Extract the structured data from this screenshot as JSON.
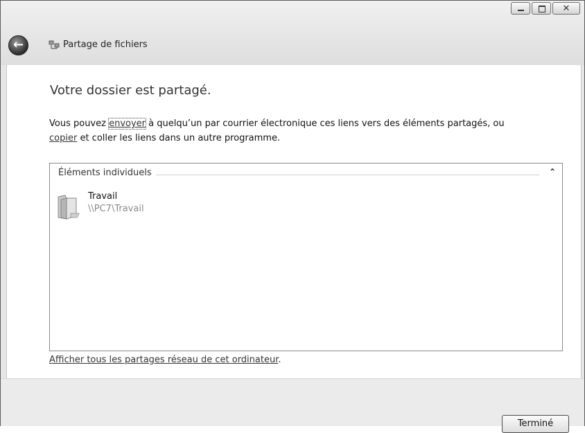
{
  "window": {
    "title": "Partage de fichiers",
    "close_glyph": "✕",
    "back_glyph": "←"
  },
  "main": {
    "heading": "Votre dossier est partagé.",
    "desc_prefix": "Vous pouvez ",
    "link_send": "envoyer",
    "desc_middle": " à quelqu’un par courrier électronique ces liens vers des éléments partagés, ou",
    "link_copy": "copier",
    "desc_suffix": " et coller les liens dans un autre programme."
  },
  "list": {
    "group_label": "Éléments individuels",
    "chevron": "⌃",
    "items": [
      {
        "name": "Travail",
        "path": "\\\\PC7\\Travail",
        "icon": "folder-icon"
      }
    ]
  },
  "footer": {
    "link": "Afficher tous les partages réseau de cet ordinateur",
    "link_suffix": "."
  },
  "buttons": {
    "done": "Terminé"
  }
}
